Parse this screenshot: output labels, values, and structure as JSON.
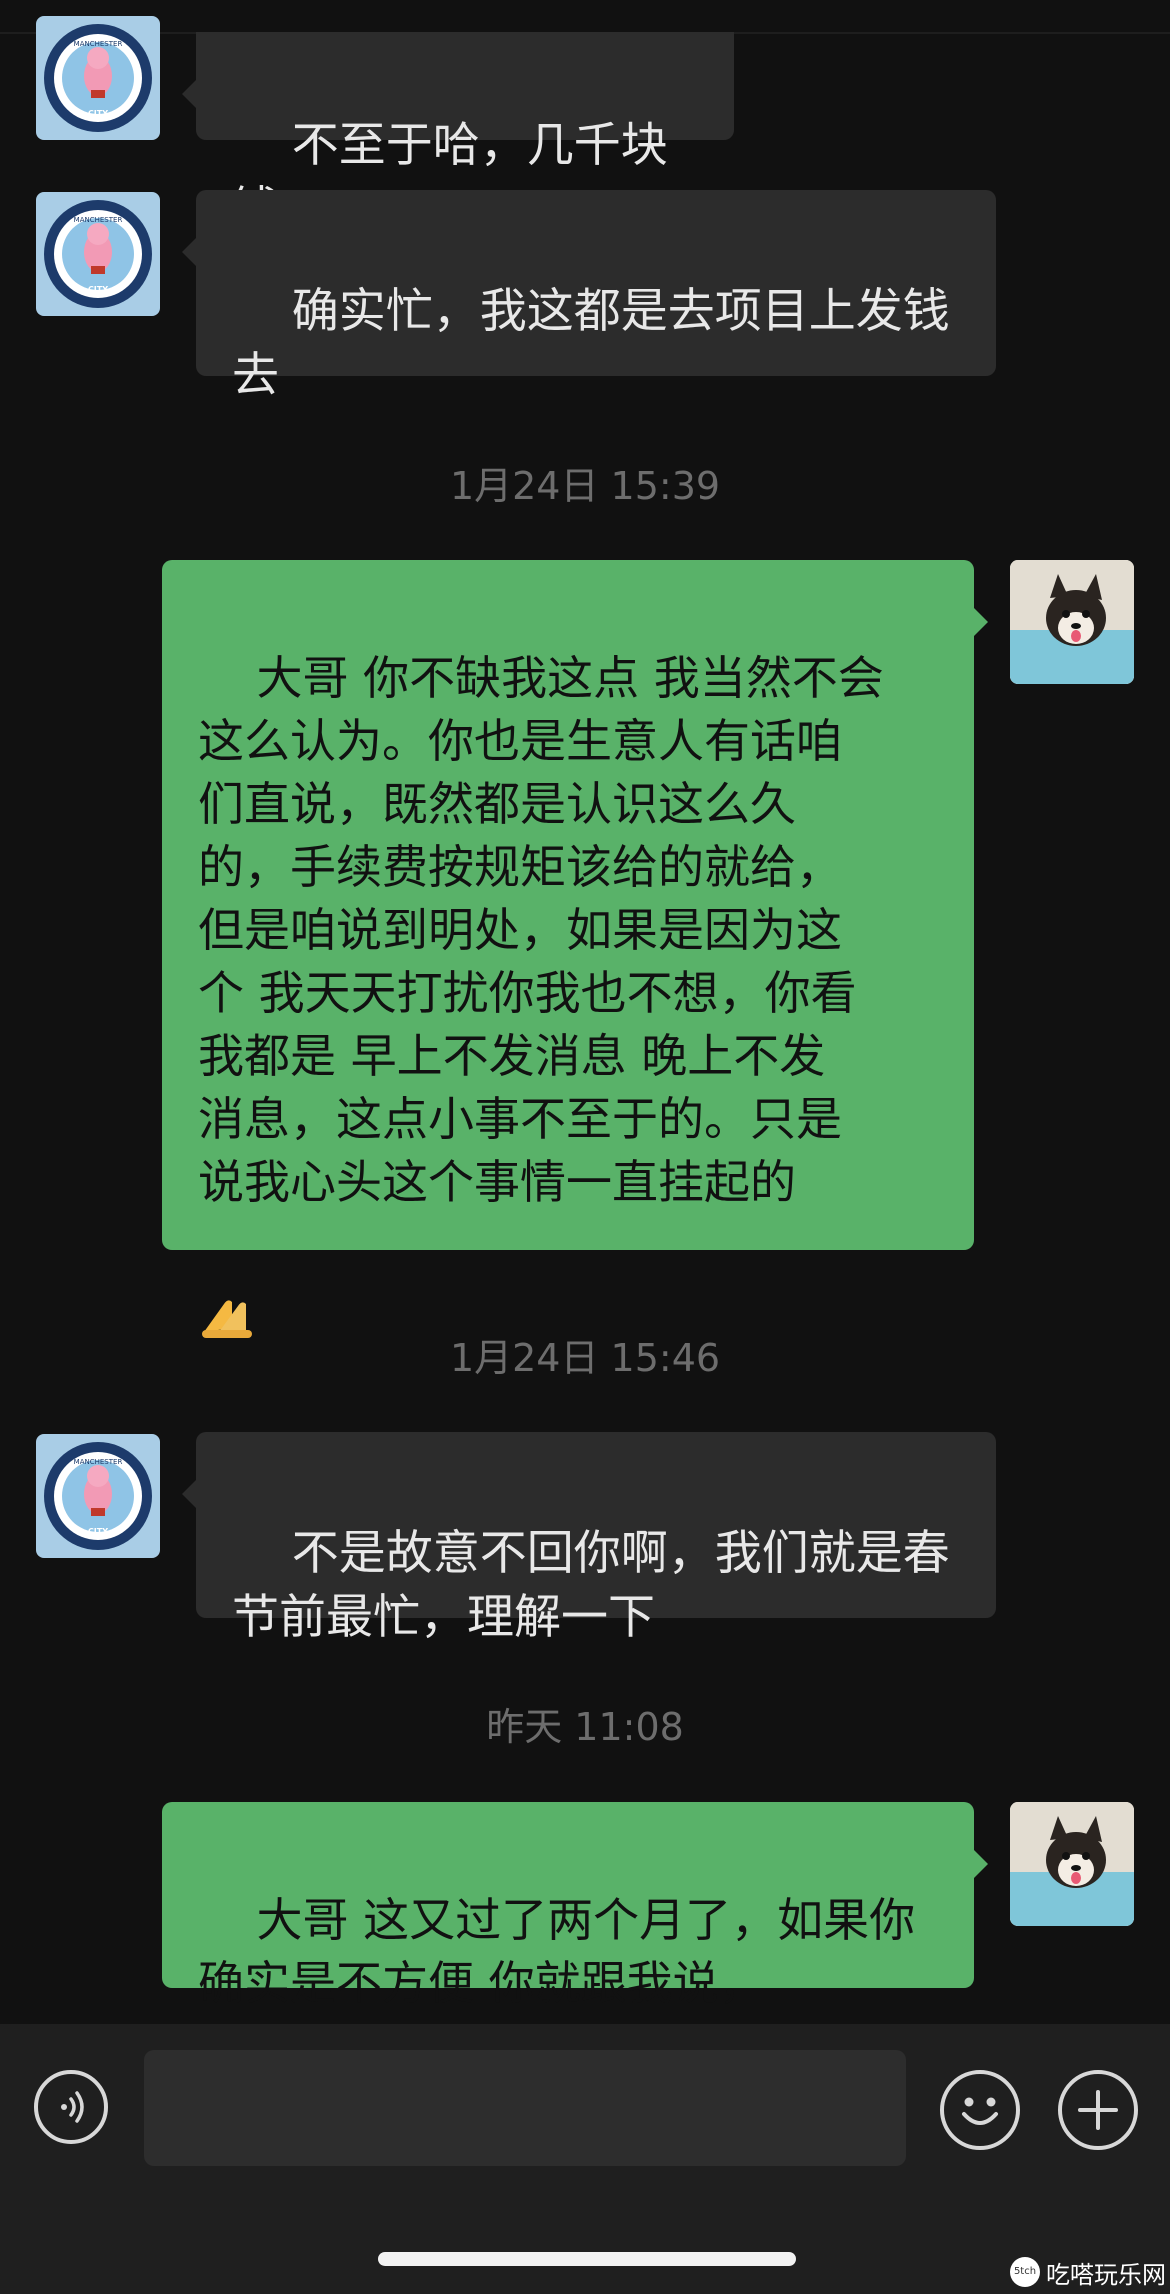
{
  "chat": {
    "messages": [
      {
        "side": "received",
        "text": "不至于哈，几千块钱"
      },
      {
        "side": "received",
        "text": "确实忙，我这都是去项目上发钱\n去"
      },
      {
        "timestamp": "1月24日 15:39"
      },
      {
        "side": "sent",
        "text": "大哥 你不缺我这点 我当然不会\n这么认为。你也是生意人有话咱\n们直说，既然都是认识这么久\n的，手续费按规矩该给的就给，\n但是咱说到明处，如果是因为这\n个 我天天打扰你我也不想，你看\n我都是 早上不发消息 晚上不发\n消息，这点小事不至于的。只是\n说我心头这个事情一直挂起的"
      },
      {
        "timestamp": "1月24日 15:46"
      },
      {
        "side": "received",
        "text": "不是故意不回你啊，我们就是春\n节前最忙，理解一下"
      },
      {
        "timestamp": "昨天 11:08"
      },
      {
        "side": "sent",
        "text": "大哥 这又过了两个月了，如果你\n确实是不方便 你就跟我说，"
      }
    ],
    "emoji": "pray-hands-icon",
    "contact_avatar_text": [
      "MANCHESTER",
      "CITY"
    ]
  },
  "input_bar": {
    "placeholder": "",
    "voice_icon": "voice-icon",
    "emoji_icon": "emoji-icon",
    "plus_icon": "plus-icon"
  },
  "watermark": {
    "logo_text": "5tch",
    "text": "吃嗒玩乐网"
  },
  "colors": {
    "background": "#111111",
    "received_bubble": "#2c2c2c",
    "sent_bubble": "#59b269",
    "timestamp": "#6d6d6d"
  }
}
